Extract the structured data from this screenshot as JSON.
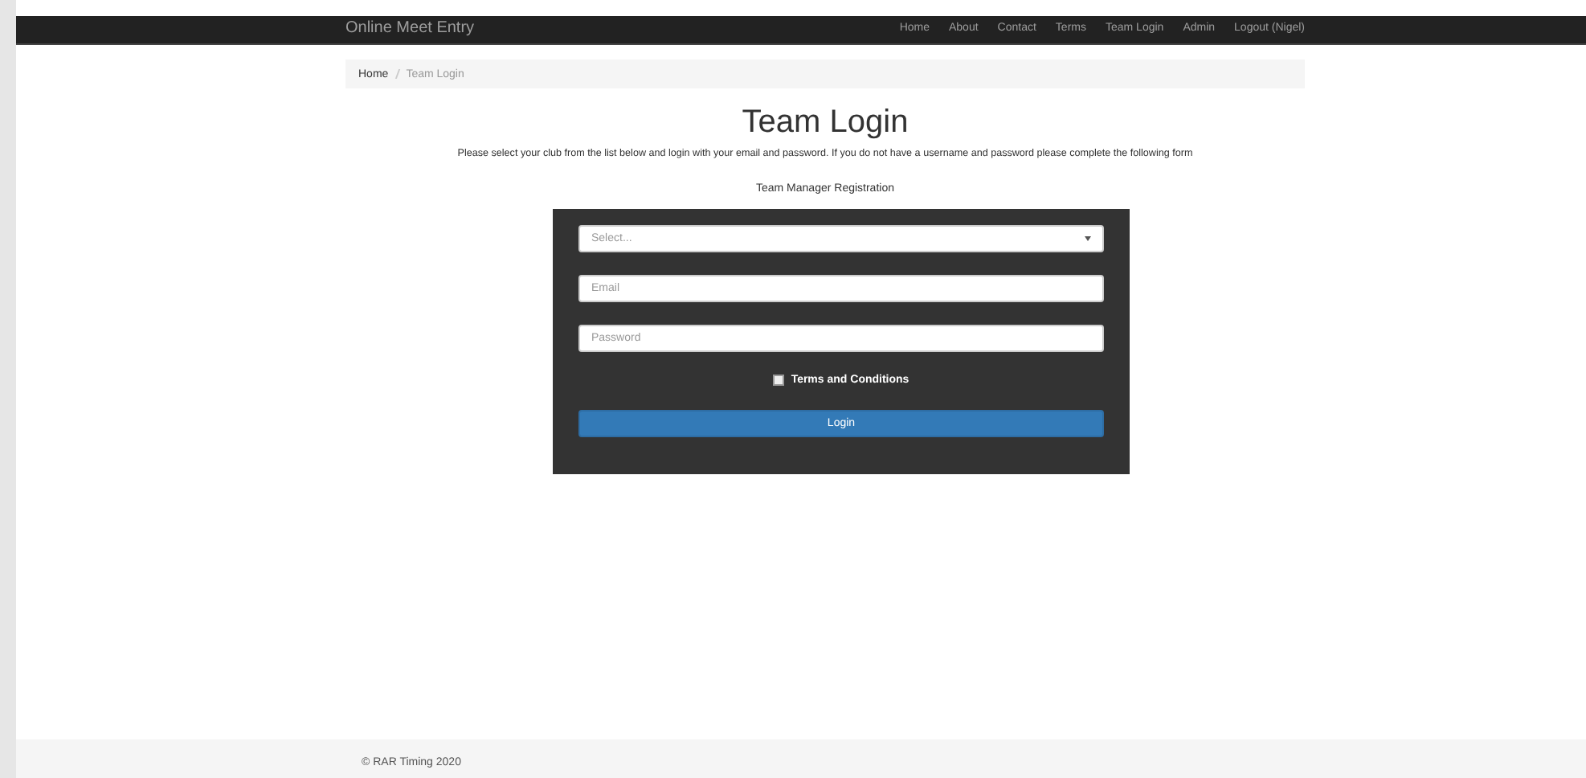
{
  "navbar": {
    "brand": "Online Meet Entry",
    "links": [
      "Home",
      "About",
      "Contact",
      "Terms",
      "Team Login",
      "Admin",
      "Logout (Nigel)"
    ]
  },
  "breadcrumb": [
    {
      "label": "Home",
      "selected": false
    },
    {
      "label": "Team Login",
      "selected": true
    }
  ],
  "title": "Team Login",
  "intro": "Please select your club from the list below and login with your email and password. If you do not have a username and password please complete the following form",
  "registration_link": "Team Manager Registration",
  "form": {
    "club_select": {
      "placeholder": "Select..."
    },
    "email": {
      "placeholder": "Email"
    },
    "password": {
      "placeholder": "Password"
    },
    "terms": {
      "label": "Terms and Conditions",
      "checked": false
    },
    "submit": "Login"
  },
  "footer": "© RAR Timing 2020"
}
